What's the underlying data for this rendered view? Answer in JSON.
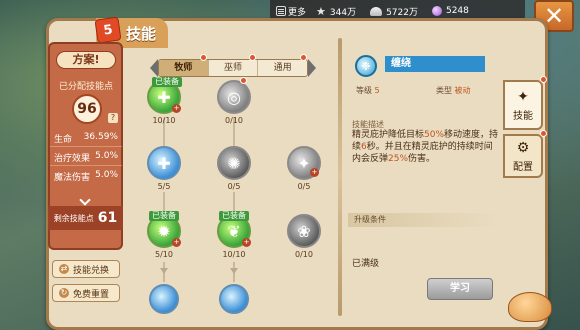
{
  "topbar": {
    "more": "更多",
    "coins": "344万",
    "shells": "5722万",
    "gems": "5248"
  },
  "header": {
    "badge": "5",
    "title": "技能"
  },
  "left": {
    "scheme": "方案!",
    "allotted_label": "已分配技能点",
    "allotted_value": "96",
    "help": "?",
    "stats": [
      {
        "label": "生命",
        "value": "36.59%"
      },
      {
        "label": "治疗效果",
        "value": "5.0%"
      },
      {
        "label": "魔法伤害",
        "value": "5.0%"
      }
    ],
    "remain_label": "剩余技能点",
    "remain_value": "61",
    "exchange": "技能兑换",
    "reset": "免费重置"
  },
  "tabs": [
    "牧师",
    "巫师",
    "通用"
  ],
  "nodes": {
    "equipped_tag": "已装备",
    "n1": {
      "level": "10/10",
      "icon": "✚"
    },
    "n2": {
      "level": "0/10",
      "icon": "◎"
    },
    "n3": {
      "level": "5/5",
      "icon": "✚"
    },
    "n4": {
      "level": "0/5",
      "icon": "✺"
    },
    "n5": {
      "level": "0/5",
      "icon": "✦"
    },
    "n6": {
      "level": "5/10",
      "icon": "✹"
    },
    "n7": {
      "level": "10/10",
      "icon": "❦"
    },
    "n8": {
      "level": "0/10",
      "icon": "❀"
    }
  },
  "detail": {
    "icon": "❉",
    "name": "缠绕",
    "level_label": "等级",
    "level_value": "5",
    "type_label": "类型",
    "type_value": "被动",
    "desc_title": "技能描述",
    "desc_1": "精灵庇护降低目标",
    "desc_h1": "50%",
    "desc_2": "移动速度，持续",
    "desc_h2": "6",
    "desc_3": "秒。并且在精灵庇护的持续时间内会反弹",
    "desc_h3": "25%",
    "desc_4": "伤害。",
    "upgrade_label": "升级条件",
    "maxed": "已满级",
    "learn": "学习"
  },
  "side": {
    "skill": "技能",
    "config": "配置"
  },
  "colors": {
    "accent": "#c46a46",
    "equipped": "#3c9a3a",
    "name_bar": "#2f8fcc"
  }
}
